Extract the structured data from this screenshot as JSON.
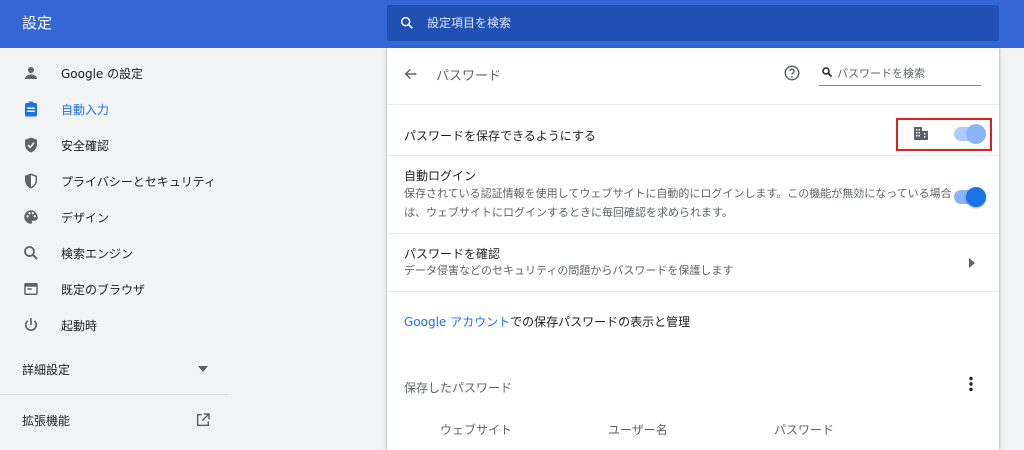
{
  "app": {
    "title": "設定"
  },
  "search": {
    "placeholder": "設定項目を検索"
  },
  "sidebar": {
    "items": [
      {
        "label": "Google の設定",
        "icon": "person-icon"
      },
      {
        "label": "自動入力",
        "icon": "clipboard-icon"
      },
      {
        "label": "安全確認",
        "icon": "shield-check-icon"
      },
      {
        "label": "プライバシーとセキュリティ",
        "icon": "shield-icon"
      },
      {
        "label": "デザイン",
        "icon": "palette-icon"
      },
      {
        "label": "検索エンジン",
        "icon": "search-icon"
      },
      {
        "label": "既定のブラウザ",
        "icon": "browser-icon"
      },
      {
        "label": "起動時",
        "icon": "power-icon"
      }
    ],
    "advanced_label": "詳細設定",
    "extensions_label": "拡張機能"
  },
  "passwords_page": {
    "title": "パスワード",
    "search_placeholder": "パスワードを検索",
    "offer_to_save": {
      "label": "パスワードを保存できるようにする",
      "enabled": true,
      "managed": true
    },
    "auto_signin": {
      "label": "自動ログイン",
      "description": "保存されている認証情報を使用してウェブサイトに自動的にログインします。この機能が無効になっている場合は、ウェブサイトにログインするときに毎回確認を求められます。",
      "enabled": true
    },
    "check_passwords": {
      "label": "パスワードを確認",
      "description": "データ侵害などのセキュリティの問題からパスワードを保護します"
    },
    "account_link": {
      "link_text": "Google アカウント",
      "suffix": "での保存パスワードの表示と管理"
    },
    "saved": {
      "title": "保存したパスワード",
      "columns": [
        "ウェブサイト",
        "ユーザー名",
        "パスワード"
      ]
    }
  },
  "colors": {
    "header": "#3367d6",
    "accent": "#1a73e8",
    "highlight_border": "#e0201c"
  }
}
